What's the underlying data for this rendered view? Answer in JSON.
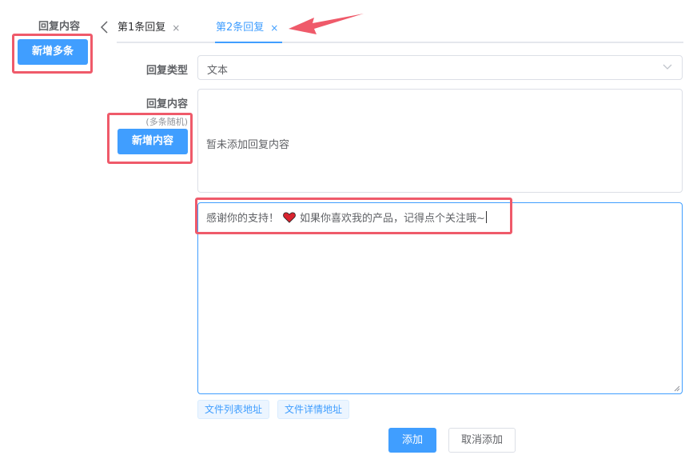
{
  "left": {
    "section_label": "回复内容",
    "add_multi_button": "新增多条"
  },
  "tabs": [
    {
      "label": "第1条回复",
      "close": "×",
      "active": false
    },
    {
      "label": "第2条回复",
      "close": "×",
      "active": true
    }
  ],
  "form": {
    "type_label": "回复类型",
    "type_value": "文本",
    "content_label": "回复内容",
    "content_sublabel": "(多条随机)",
    "add_content_button": "新增内容",
    "empty_text": "暂未添加回复内容",
    "textarea_before": "感谢你的支持！",
    "textarea_after": "如果你喜欢我的产品，记得点个关注哦~",
    "tags": [
      "文件列表地址",
      "文件详情地址"
    ],
    "submit_button": "添加",
    "cancel_button": "取消添加"
  },
  "colors": {
    "primary": "#409eff",
    "highlight": "#ef5a6a"
  },
  "icons": {
    "tab_prev": "chevron-left-icon",
    "tab_close": "close-icon",
    "select_arrow": "chevron-down-icon",
    "emoji": "heart-icon",
    "annotation": "arrow-annotation"
  }
}
